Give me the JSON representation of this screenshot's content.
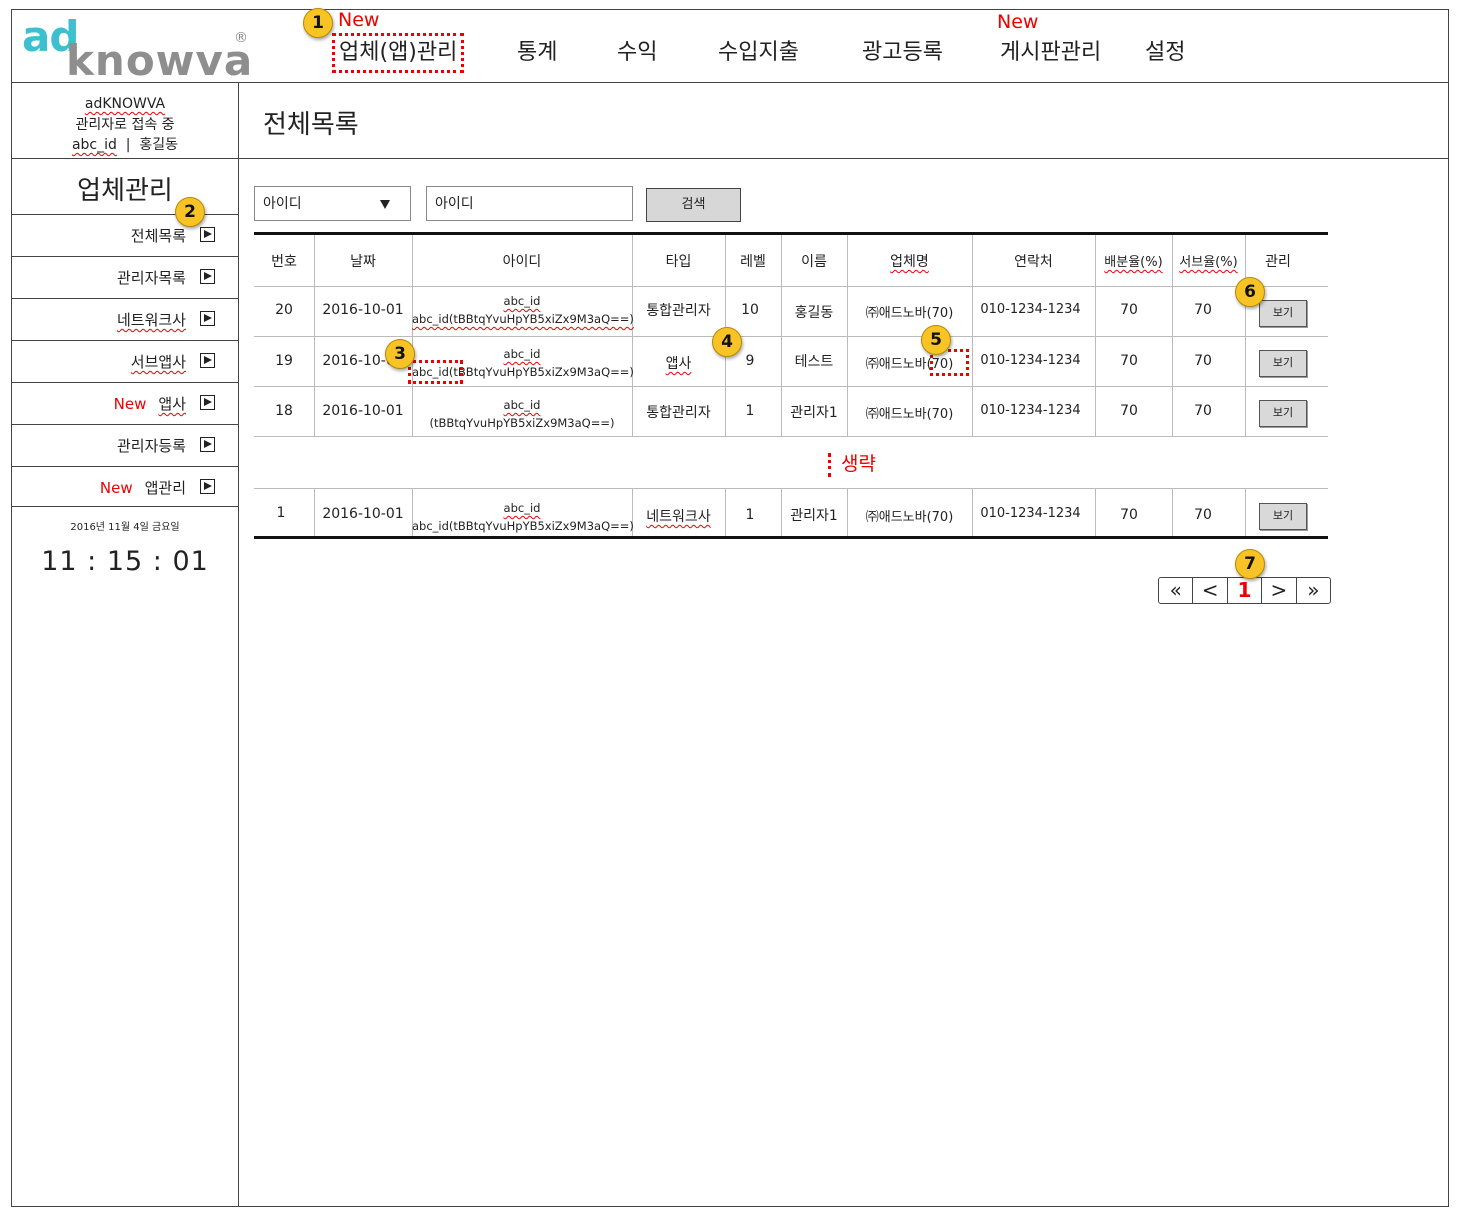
{
  "logo": {
    "ad": "ad",
    "knowva": "knowva",
    "reg": "®"
  },
  "nav": {
    "items": [
      "업체(앱)관리",
      "통계",
      "수익",
      "수입지출",
      "광고등록",
      "게시판관리",
      "설정"
    ],
    "new_label_1": "New",
    "new_label_2": "New"
  },
  "markers": [
    "1",
    "2",
    "3",
    "4",
    "5",
    "6",
    "7"
  ],
  "user": {
    "line1": "adKNOWVA",
    "line2": "관리자로 접속 중",
    "id": "abc_id",
    "sep": "|",
    "name": "홍길동"
  },
  "page_title": "전체목록",
  "sidebar": {
    "title": "업체관리",
    "items": [
      {
        "label": "전체목록",
        "new": ""
      },
      {
        "label": "관리자목록",
        "new": ""
      },
      {
        "label": "네트워크사",
        "new": ""
      },
      {
        "label": "서브앱사",
        "new": ""
      },
      {
        "label": "앱사",
        "new": "New"
      },
      {
        "label": "관리자등록",
        "new": ""
      },
      {
        "label": "앱관리",
        "new": "New"
      }
    ],
    "date": "2016년 11월 4일 금요일",
    "clock": "11 : 15 : 01"
  },
  "search": {
    "select_value": "아이디",
    "input_value": "아이디",
    "button_label": "검색"
  },
  "table": {
    "headers": [
      "번호",
      "날짜",
      "아이디",
      "타입",
      "레벨",
      "이름",
      "업체명",
      "연락처",
      "배분율(%)",
      "서브율(%)",
      "관리"
    ],
    "rows": [
      {
        "no": "20",
        "date": "2016-10-01",
        "id_top": "abc_id",
        "id_bottom": "abc_id(tBBtqYvuHpYB5xiZx9M3aQ==)",
        "type": "통합관리자",
        "level": "10",
        "name": "홍길동",
        "company": "㈜애드노바(70)",
        "contact": "010-1234-1234",
        "dist": "70",
        "sub": "70",
        "action": "보기"
      },
      {
        "no": "19",
        "date": "2016-10-01",
        "id_top": "abc_id",
        "id_bottom": "abc_id(tBBtqYvuHpYB5xiZx9M3aQ==)",
        "type": "앱사",
        "level": "9",
        "name": "테스트",
        "company": "㈜애드노바(70)",
        "contact": "010-1234-1234",
        "dist": "70",
        "sub": "70",
        "action": "보기"
      },
      {
        "no": "18",
        "date": "2016-10-01",
        "id_top": "abc_id",
        "id_bottom": "(tBBtqYvuHpYB5xiZx9M3aQ==)",
        "type": "통합관리자",
        "level": "1",
        "name": "관리자1",
        "company": "㈜애드노바(70)",
        "contact": "010-1234-1234",
        "dist": "70",
        "sub": "70",
        "action": "보기"
      },
      {
        "no": "1",
        "date": "2016-10-01",
        "id_top": "abc_id",
        "id_bottom": "abc_id(tBBtqYvuHpYB5xiZx9M3aQ==)",
        "type": "네트워크사",
        "level": "1",
        "name": "관리자1",
        "company": "㈜애드노바(70)",
        "contact": "010-1234-1234",
        "dist": "70",
        "sub": "70",
        "action": "보기"
      }
    ],
    "omitted_label": "생략"
  },
  "pagination": {
    "first": "«",
    "prev": "<",
    "current": "1",
    "next": ">",
    "last": "»"
  },
  "colors": {
    "accent_red": "#e00000",
    "logo_teal": "#3cc0cf",
    "logo_gray": "#8e8e8e",
    "marker_yellow": "#f7c325"
  }
}
